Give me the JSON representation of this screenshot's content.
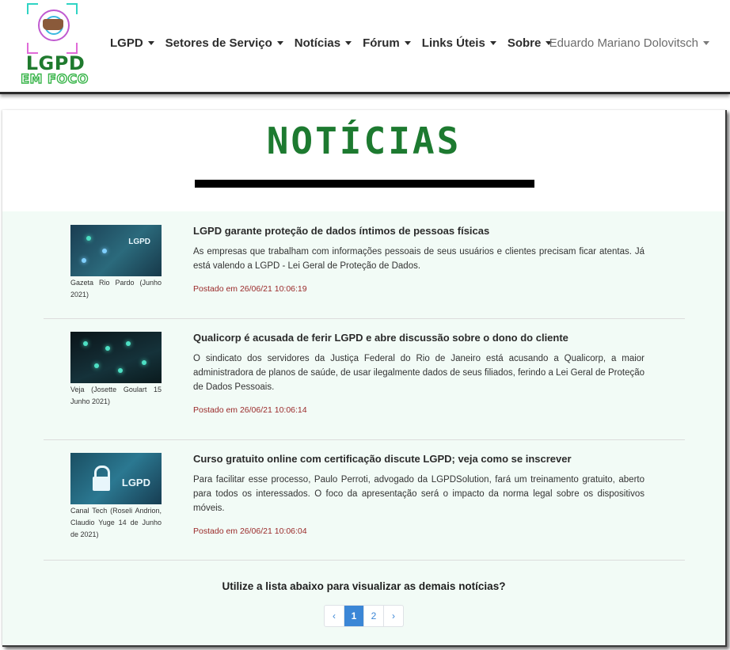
{
  "logo": {
    "line1": "LGPD",
    "line2": "EM FOCO"
  },
  "nav": {
    "items": [
      {
        "label": "LGPD"
      },
      {
        "label": "Setores de Serviço"
      },
      {
        "label": "Notícias"
      },
      {
        "label": "Fórum"
      },
      {
        "label": "Links Úteis"
      },
      {
        "label": "Sobre"
      }
    ],
    "user": "Eduardo Mariano Dolovitsch"
  },
  "page": {
    "title": "NOTÍCIAS"
  },
  "news": [
    {
      "title": "LGPD garante proteção de dados íntimos de pessoas físicas",
      "text": "As empresas que trabalham com informações pessoais de seus usuários e clientes precisam ficar atentas. Já está valendo a LGPD - Lei Geral de Proteção de Dados.",
      "date": "Postado em 26/06/21 10:06:19",
      "caption": "Gazeta Rio Pardo (Junho 2021)",
      "thumb_label": "LGPD"
    },
    {
      "title": "Qualicorp é acusada de ferir LGPD e abre discussão sobre o dono do cliente",
      "text": "O sindicato dos servidores da Justiça Federal do Rio de Janeiro está acusando a Qualicorp, a maior administradora de planos de saúde, de usar ilegalmente dados de seus filiados, ferindo a Lei Geral de Proteção de Dados Pessoais.",
      "date": "Postado em 26/06/21 10:06:14",
      "caption": "Veja (Josette Goulart 15 Junho 2021)",
      "thumb_label": ""
    },
    {
      "title": "Curso gratuito online com certificação discute LGPD; veja como se inscrever",
      "text": "Para facilitar esse processo, Paulo Perroti, advogado da LGPDSolution, fará um treinamento gratuito, aberto para todos os interessados. O foco da apresentação será o impacto da norma legal sobre os dispositivos móveis.",
      "date": "Postado em 26/06/21 10:06:04",
      "caption": "Canal Tech (Roseli Andrion, Claudio Yuge 14 de Junho de 2021)",
      "thumb_label": "LGPD"
    }
  ],
  "pagination": {
    "prompt": "Utilize a lista abaixo para visualizar as demais notícias?",
    "prev": "‹",
    "pages": [
      "1",
      "2"
    ],
    "next": "›"
  }
}
